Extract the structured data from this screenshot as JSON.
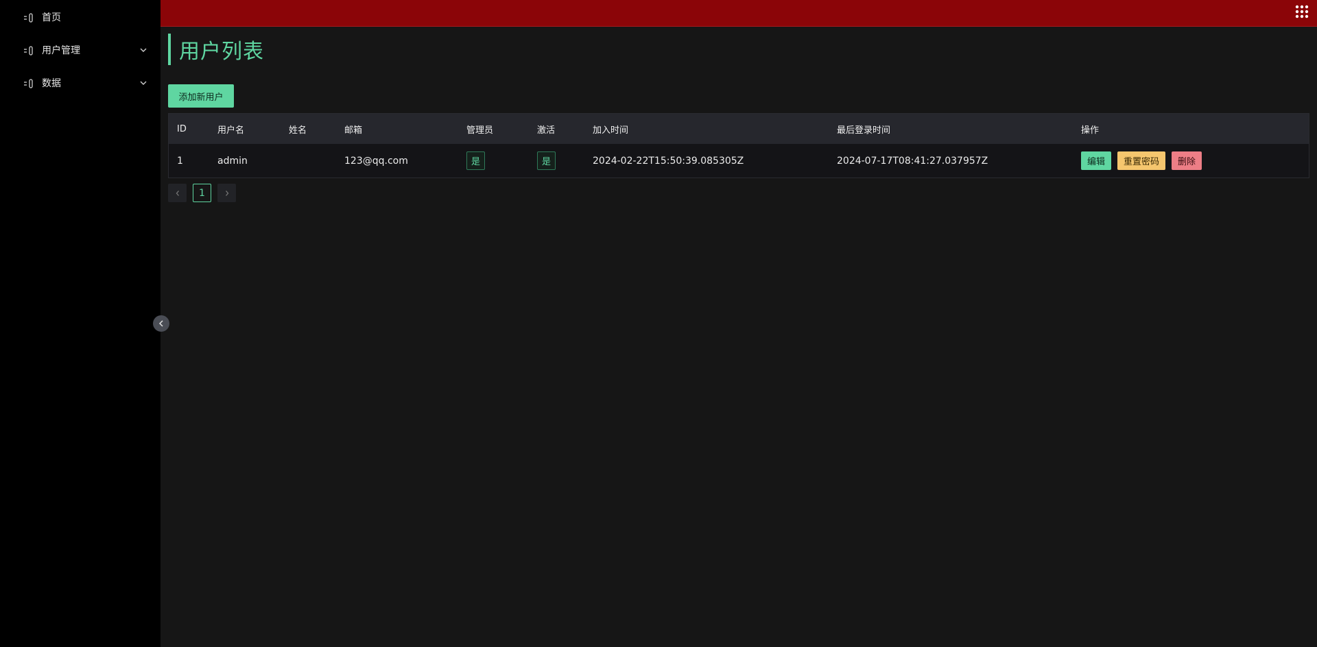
{
  "sidebar": {
    "items": [
      {
        "label": "首页",
        "icon": "page-icon",
        "expandable": false
      },
      {
        "label": "用户管理",
        "icon": "page-icon",
        "expandable": true
      },
      {
        "label": "数据",
        "icon": "page-icon",
        "expandable": true
      }
    ]
  },
  "header": {
    "apps_icon": "grid-dots-icon"
  },
  "page": {
    "title": "用户列表",
    "add_button_label": "添加新用户"
  },
  "table": {
    "columns": [
      "ID",
      "用户名",
      "姓名",
      "邮箱",
      "管理员",
      "激活",
      "加入时间",
      "最后登录时间",
      "操作"
    ],
    "rows": [
      {
        "id": "1",
        "username": "admin",
        "name": "",
        "email": "123@qq.com",
        "is_admin": "是",
        "is_active": "是",
        "joined": "2024-02-22T15:50:39.085305Z",
        "last_login": "2024-07-17T08:41:27.037957Z",
        "actions": {
          "edit": "编辑",
          "reset": "重置密码",
          "delete": "删除"
        }
      }
    ]
  },
  "pagination": {
    "current_page": "1"
  },
  "colors": {
    "accent": "#5fd6a1",
    "topbar": "#8b0508",
    "warning": "#f5c66e",
    "danger": "#ed7e86"
  }
}
